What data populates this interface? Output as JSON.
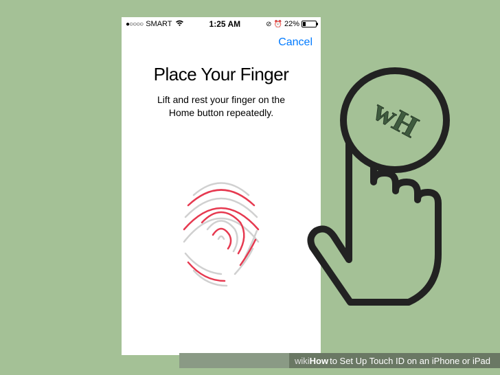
{
  "status": {
    "signal_dots": "●○○○○",
    "carrier": "SMART",
    "time": "1:25 AM",
    "battery_pct": "22%"
  },
  "nav": {
    "cancel": "Cancel"
  },
  "content": {
    "title": "Place Your Finger",
    "subtitle_l1": "Lift and rest your finger on the",
    "subtitle_l2": "Home button repeatedly."
  },
  "caption": {
    "wiki": "wiki",
    "how": "How",
    "rest": " to Set Up Touch ID on an iPhone or iPad"
  },
  "watermark": {
    "text": "wH"
  }
}
